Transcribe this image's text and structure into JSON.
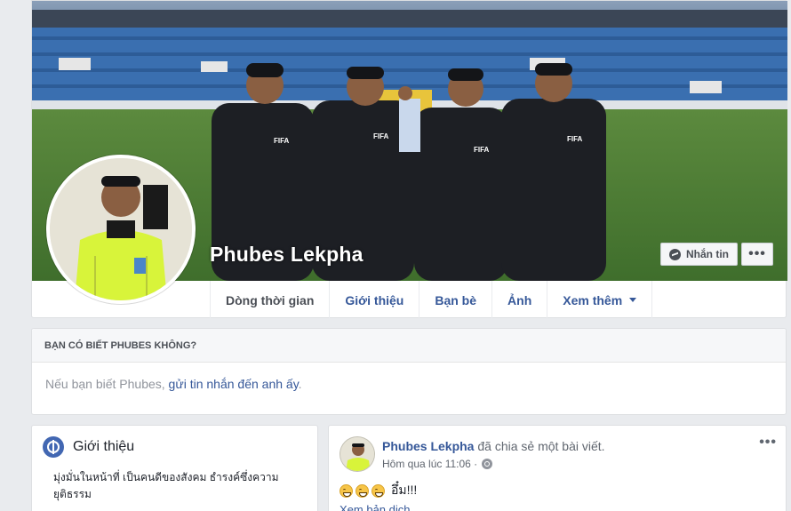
{
  "profile": {
    "name": "Phubes Lekpha"
  },
  "cover_actions": {
    "message_label": "Nhắn tin",
    "more_label": "•••"
  },
  "tabs": [
    {
      "label": "Dòng thời gian"
    },
    {
      "label": "Giới thiệu"
    },
    {
      "label": "Bạn bè"
    },
    {
      "label": "Ảnh"
    },
    {
      "label": "Xem thêm"
    }
  ],
  "know_card": {
    "title": "Bạn có biết Phubes không?",
    "body_prefix": "Nếu bạn biết Phubes, ",
    "body_link": "gửi tin nhắn đến anh ấy",
    "body_suffix": "."
  },
  "intro": {
    "title": "Giới thiệu",
    "bio": "มุ่งมั่นในหน้าที่ เป็นคนดีของสังคม ธำรงค์ซึ่งความยุติธรรม"
  },
  "post": {
    "author": "Phubes Lekpha",
    "action": " đã chia sẻ một bài viết.",
    "time": "Hôm qua lúc 11:06 ·",
    "text": "อึ๋ม!!!",
    "translate": "Xem bản dịch",
    "menu": "•••"
  },
  "colors": {
    "link": "#365899",
    "background": "#e9ebee",
    "referee_shirt": "#d8f43a"
  }
}
